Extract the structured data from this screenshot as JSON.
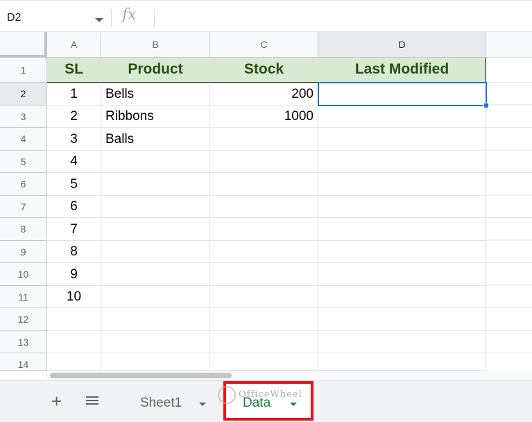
{
  "formula_bar": {
    "cell_ref": "D2",
    "fx_symbol": "fx",
    "formula": ""
  },
  "columns": [
    "A",
    "B",
    "C",
    "D"
  ],
  "rows": [
    "1",
    "2",
    "3",
    "4",
    "5",
    "6",
    "7",
    "8",
    "9",
    "10",
    "11",
    "12",
    "13",
    "14"
  ],
  "table": {
    "headers": [
      "SL",
      "Product",
      "Stock",
      "Last Modified"
    ],
    "sl": [
      "1",
      "2",
      "3",
      "4",
      "5",
      "6",
      "7",
      "8",
      "9",
      "10"
    ],
    "products": [
      "Bells",
      "Ribbons",
      "Balls"
    ],
    "stock": [
      "200",
      "1000"
    ]
  },
  "selected_cell": "D2",
  "sheet_tabs": [
    {
      "label": "Sheet1",
      "active": false
    },
    {
      "label": "Data",
      "active": true
    }
  ],
  "watermark": "OfficeWheel",
  "colors": {
    "header_fill": "#d9ead3",
    "header_text": "#274e13",
    "selection": "#1a73e8",
    "active_tab_text": "#188038",
    "highlight_box": "#e8141c"
  }
}
